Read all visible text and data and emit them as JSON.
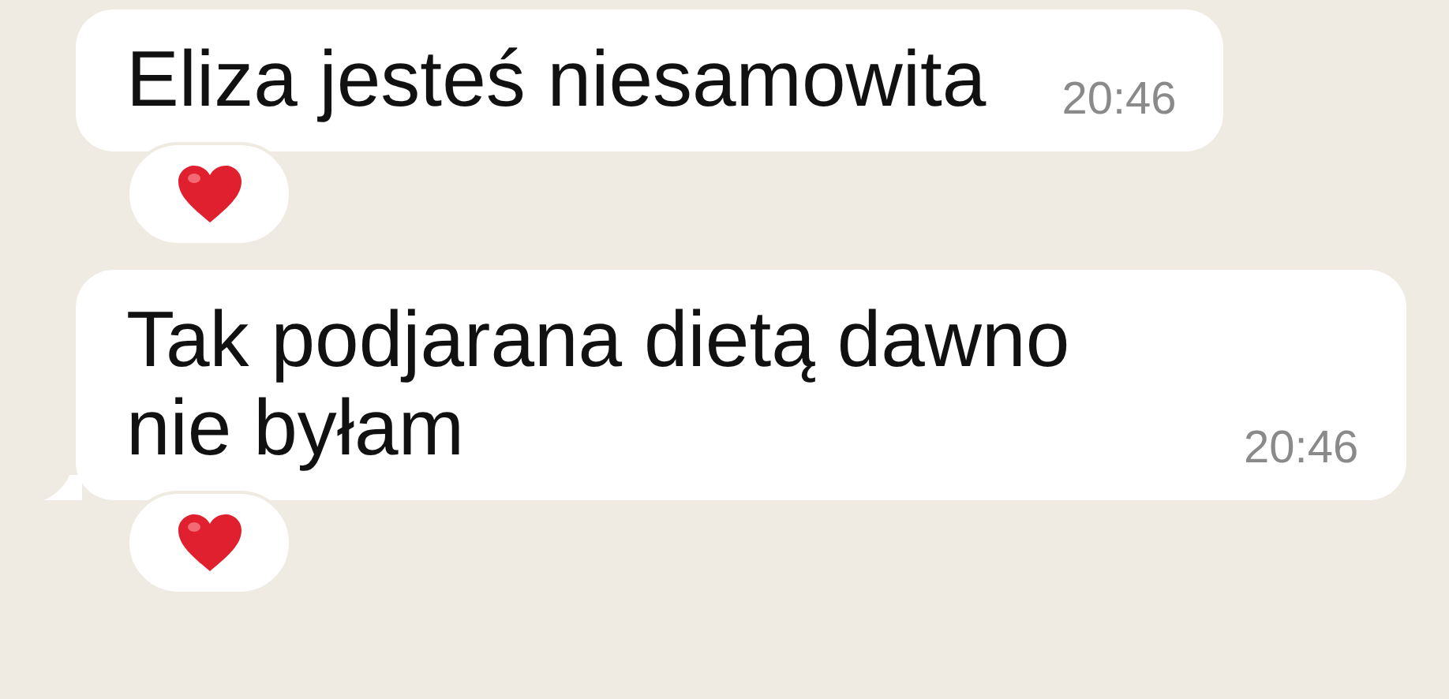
{
  "messages": [
    {
      "text": "Eliza jesteś niesamowita",
      "time": "20:46",
      "tail": false,
      "reaction": true
    },
    {
      "text": "Tak podjarana dietą dawno nie byłam",
      "time": "20:46",
      "tail": true,
      "reaction": true
    }
  ]
}
